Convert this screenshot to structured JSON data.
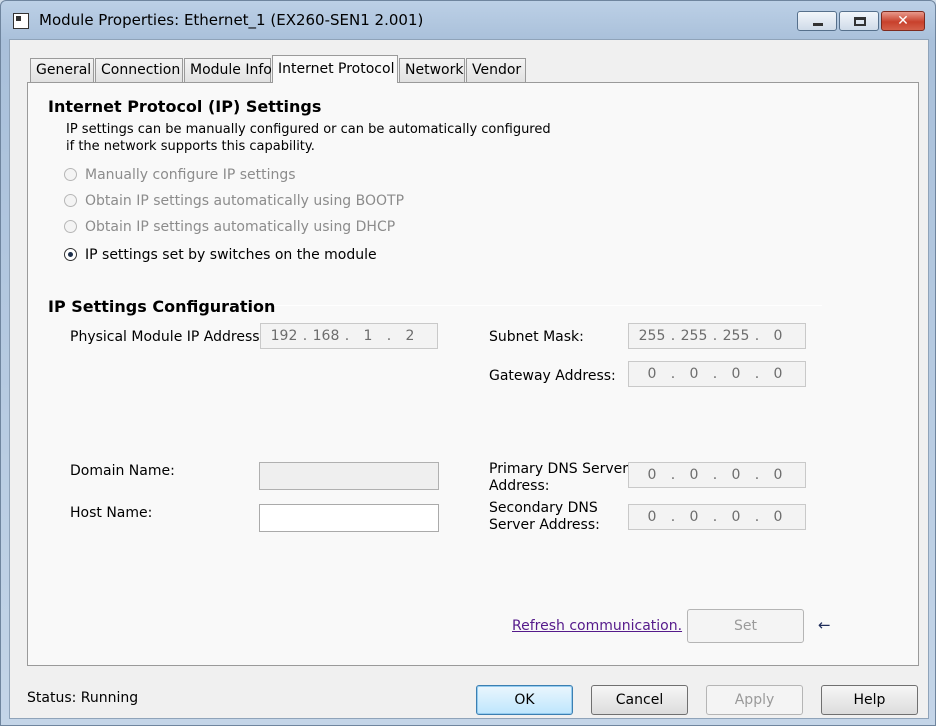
{
  "window": {
    "title": "Module Properties: Ethernet_1 (EX260-SEN1 2.001)",
    "controls": {
      "minimize": "minimize",
      "maximize": "maximize",
      "close": "✕"
    }
  },
  "tabs": [
    {
      "label": "General"
    },
    {
      "label": "Connection"
    },
    {
      "label": "Module Info"
    },
    {
      "label": "Internet Protocol",
      "active": true
    },
    {
      "label": "Network"
    },
    {
      "label": "Vendor"
    }
  ],
  "ip_settings": {
    "heading": "Internet Protocol (IP) Settings",
    "description_line1": "IP settings can be manually configured or can be automatically configured",
    "description_line2": "if the network supports this capability.",
    "options": [
      {
        "label": "Manually configure IP settings",
        "selected": false,
        "enabled": false
      },
      {
        "label": "Obtain IP settings automatically using BOOTP",
        "selected": false,
        "enabled": false
      },
      {
        "label": "Obtain IP settings automatically using DHCP",
        "selected": false,
        "enabled": false
      },
      {
        "label": "IP settings set by switches on the module",
        "selected": true,
        "enabled": true
      }
    ]
  },
  "config": {
    "heading": "IP Settings Configuration",
    "physical_ip_label": "Physical Module IP Address:",
    "physical_ip": [
      "192",
      "168",
      "1",
      "2"
    ],
    "subnet_label": "Subnet Mask:",
    "subnet": [
      "255",
      "255",
      "255",
      "0"
    ],
    "gateway_label": "Gateway Address:",
    "gateway": [
      "0",
      "0",
      "0",
      "0"
    ],
    "domain_label": "Domain Name:",
    "domain_value": "",
    "host_label": "Host Name:",
    "host_value": "",
    "primary_dns_label_line1": "Primary DNS Server",
    "primary_dns_label_line2": "Address:",
    "primary_dns": [
      "0",
      "0",
      "0",
      "0"
    ],
    "secondary_dns_label_line1": "Secondary DNS",
    "secondary_dns_label_line2": "Server Address:",
    "secondary_dns": [
      "0",
      "0",
      "0",
      "0"
    ],
    "refresh_link": "Refresh communication.",
    "set_button": "Set"
  },
  "footer": {
    "status": "Status:  Running",
    "ok": "OK",
    "cancel": "Cancel",
    "apply": "Apply",
    "help": "Help"
  }
}
